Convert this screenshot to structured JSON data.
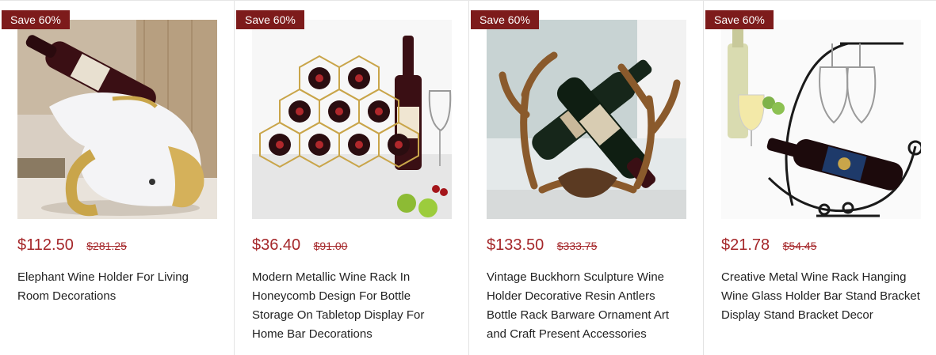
{
  "products": [
    {
      "badge": "Save 60%",
      "price": "$112.50",
      "original_price": "$281.25",
      "title": "Elephant Wine Holder For Living Room Decorations",
      "image_icon": "elephant-wine-holder-image"
    },
    {
      "badge": "Save 60%",
      "price": "$36.40",
      "original_price": "$91.00",
      "title": "Modern Metallic Wine Rack In Honeycomb Design For Bottle Storage On Tabletop Display For Home Bar Decorations",
      "image_icon": "honeycomb-wine-rack-image"
    },
    {
      "badge": "Save 60%",
      "price": "$133.50",
      "original_price": "$333.75",
      "title": "Vintage Buckhorn Sculpture Wine Holder Decorative Resin Antlers Bottle Rack Barware Ornament Art and Craft Present Accessories",
      "image_icon": "antler-wine-holder-image"
    },
    {
      "badge": "Save 60%",
      "price": "$21.78",
      "original_price": "$54.45",
      "title": "Creative Metal Wine Rack Hanging Wine Glass Holder Bar Stand Bracket Display Stand Bracket Decor",
      "image_icon": "metal-wine-glass-rack-image"
    }
  ],
  "colors": {
    "badge_bg": "#7d1b1b",
    "price": "#a5272a"
  }
}
